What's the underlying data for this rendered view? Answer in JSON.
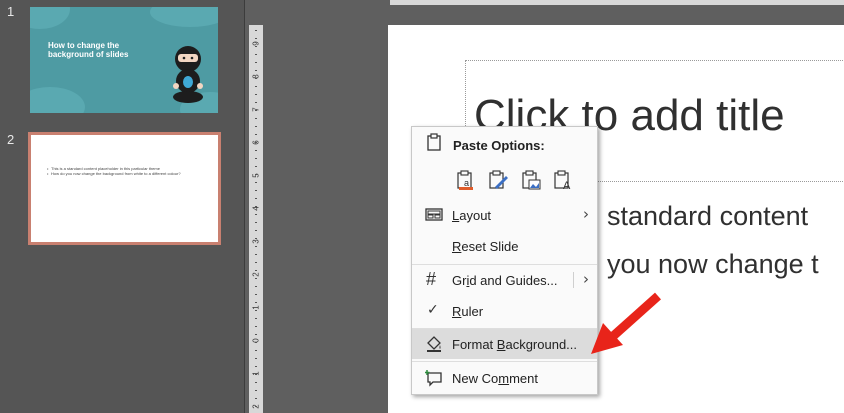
{
  "thumbnails": [
    {
      "number": "1",
      "title": "How to change the background of slides"
    },
    {
      "number": "2",
      "bullets": [
        "This is a standard content placeholder in this particular theme",
        "How do you now change the background from white to a different colour?"
      ]
    }
  ],
  "ruler": {
    "labels": [
      "9",
      "8",
      "7",
      "6",
      "5",
      "4",
      "3",
      "2",
      "1",
      "0",
      "1",
      "2"
    ]
  },
  "slide": {
    "title_placeholder": "Click to add title",
    "body_line1": "standard content",
    "body_line2": "you now change t"
  },
  "context_menu": {
    "paste_header": "Paste Options:",
    "paste_options": [
      "use-destination-theme-icon",
      "keep-source-formatting-icon",
      "picture-icon",
      "keep-text-only-icon"
    ],
    "items": [
      {
        "label": "Layout",
        "has_submenu": true
      },
      {
        "label": "Reset Slide"
      },
      {
        "label": "Grid and Guides...",
        "has_submenu": true
      },
      {
        "label": "Ruler",
        "checked": true
      },
      {
        "label": "Format Background...",
        "highlighted": true
      },
      {
        "label": "New Comment"
      }
    ]
  },
  "colors": {
    "thumb1_bg": "#4e9ba3",
    "thumb2_selected_border": "#c98070",
    "menu_highlight": "#dcdcdc",
    "arrow": "#e8241a"
  }
}
